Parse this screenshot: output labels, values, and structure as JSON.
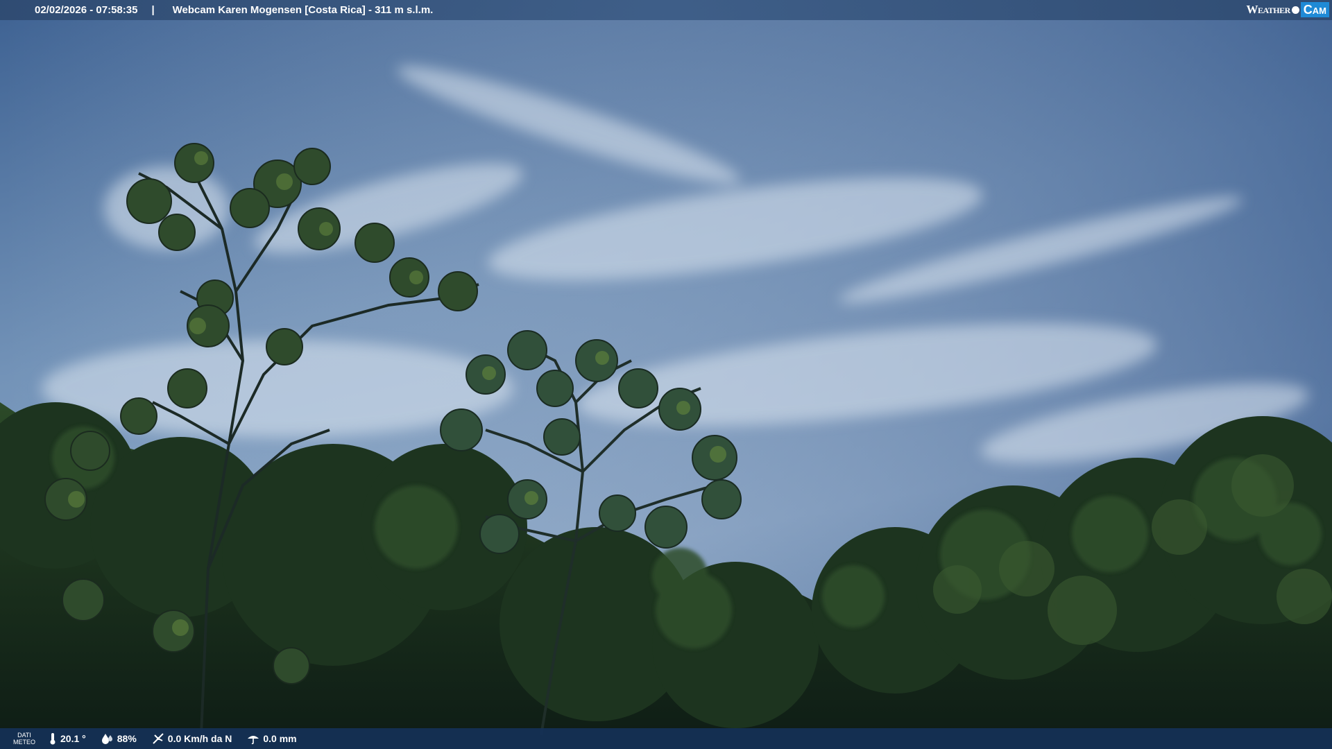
{
  "header": {
    "datetime": "02/02/2026 - 07:58:35",
    "separator": "|",
    "title": "Webcam Karen Mogensen [Costa Rica]  - 311 m s.l.m.",
    "logo_word": "Weather",
    "logo_cam": "Cam"
  },
  "footer": {
    "label_line1": "DATI",
    "label_line2": "METEO",
    "temperature": "20.1 °",
    "humidity": "88%",
    "wind": "0.0 Km/h da N",
    "rain": "0.0 mm"
  },
  "colors": {
    "sky_top": "#3b5f90",
    "sky_mid": "#7f9ec0",
    "foliage_dark": "#122218",
    "logo_accent": "#1f8ad6"
  },
  "icons": [
    "thermometer-icon",
    "humidity-icon",
    "wind-icon",
    "rain-icon"
  ]
}
